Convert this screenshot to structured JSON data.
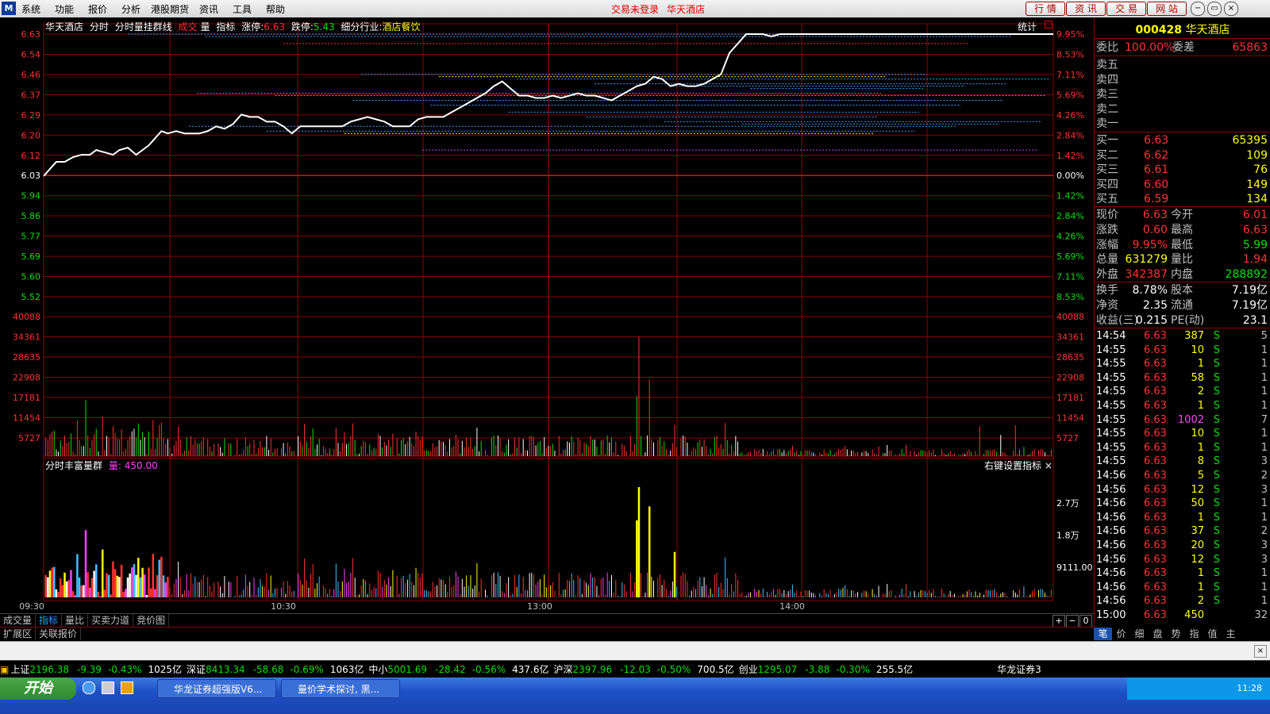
{
  "menubar": {
    "items": [
      "系统",
      "功能",
      "报价",
      "分析",
      "港股期货",
      "资讯",
      "工具",
      "帮助"
    ],
    "status_text": "交易未登录",
    "stock_title": "华天酒店",
    "right_buttons": [
      "行 情",
      "资 讯",
      "交 易",
      "网 站"
    ],
    "window_buttons": [
      "−",
      "▭",
      "×"
    ]
  },
  "chart_header": {
    "name": "华天酒店",
    "mode1": "分时",
    "mode2": "分时量挂群线",
    "vol_label1": "成交",
    "vol_label2": "量",
    "ind_label": "指标",
    "limit_up_label": "涨停:",
    "limit_up_value": "6.63",
    "limit_down_label": "跌停:",
    "limit_down_value": "5.43",
    "industry_label": "细分行业:",
    "industry_value": "酒店餐饮",
    "stat_label": "统计"
  },
  "sub_header": {
    "name": "分时丰富量群",
    "var_label": "量:",
    "var_value": "450.00",
    "right_text": "右键设置指标"
  },
  "chart_data": {
    "type": "line",
    "price_axis": {
      "left_ticks": [
        "6.63",
        "6.54",
        "6.46",
        "6.37",
        "6.29",
        "6.20",
        "6.12",
        "6.03",
        "5.94",
        "5.86",
        "5.77",
        "5.69",
        "5.60",
        "5.52"
      ],
      "right_ticks": [
        "9.95%",
        "8.53%",
        "7.11%",
        "5.69%",
        "4.26%",
        "2.84%",
        "1.42%",
        "0.00%",
        "1.42%",
        "2.84%",
        "4.26%",
        "5.69%",
        "7.11%",
        "8.53%"
      ],
      "ylim": [
        5.43,
        6.63
      ],
      "prev_close": 6.03
    },
    "volume_axis": {
      "ticks": [
        "40088",
        "34361",
        "28635",
        "22908",
        "17181",
        "11454",
        "5727"
      ],
      "ylim": [
        0,
        45815
      ]
    },
    "indicator_axis": {
      "ticks": [
        "2.7万",
        "1.8万",
        "9111.00"
      ],
      "ylim": [
        0,
        36000
      ]
    },
    "time_axis": {
      "labels": [
        "09:30",
        "10:30",
        "13:00",
        "14:00"
      ],
      "range_minutes": [
        0,
        240
      ]
    },
    "price_series": [
      [
        0,
        6.03
      ],
      [
        3,
        6.06
      ],
      [
        6,
        6.09
      ],
      [
        10,
        6.09
      ],
      [
        14,
        6.11
      ],
      [
        18,
        6.12
      ],
      [
        22,
        6.12
      ],
      [
        25,
        6.14
      ],
      [
        29,
        6.13
      ],
      [
        33,
        6.12
      ],
      [
        36,
        6.14
      ],
      [
        40,
        6.15
      ],
      [
        44,
        6.12
      ],
      [
        47,
        6.14
      ],
      [
        50,
        6.16
      ],
      [
        53,
        6.19
      ],
      [
        56,
        6.22
      ],
      [
        59,
        6.21
      ],
      [
        63,
        6.22
      ],
      [
        67,
        6.21
      ],
      [
        70,
        6.21
      ],
      [
        74,
        6.21
      ],
      [
        78,
        6.22
      ],
      [
        82,
        6.24
      ],
      [
        86,
        6.23
      ],
      [
        90,
        6.25
      ],
      [
        94,
        6.29
      ],
      [
        98,
        6.28
      ],
      [
        102,
        6.28
      ],
      [
        106,
        6.26
      ],
      [
        110,
        6.26
      ],
      [
        114,
        6.24
      ],
      [
        118,
        6.21
      ],
      [
        122,
        6.24
      ],
      [
        126,
        6.24
      ],
      [
        130,
        6.24
      ],
      [
        134,
        6.24
      ],
      [
        138,
        6.24
      ],
      [
        142,
        6.24
      ],
      [
        146,
        6.26
      ],
      [
        150,
        6.27
      ],
      [
        154,
        6.28
      ],
      [
        158,
        6.27
      ],
      [
        162,
        6.26
      ],
      [
        166,
        6.24
      ],
      [
        170,
        6.24
      ],
      [
        174,
        6.24
      ],
      [
        178,
        6.27
      ],
      [
        182,
        6.28
      ],
      [
        186,
        6.28
      ],
      [
        190,
        6.28
      ],
      [
        194,
        6.3
      ],
      [
        198,
        6.32
      ],
      [
        202,
        6.34
      ],
      [
        206,
        6.36
      ],
      [
        210,
        6.38
      ],
      [
        214,
        6.41
      ],
      [
        218,
        6.43
      ],
      [
        222,
        6.4
      ],
      [
        226,
        6.37
      ],
      [
        230,
        6.37
      ],
      [
        234,
        6.36
      ],
      [
        238,
        6.36
      ],
      [
        242,
        6.37
      ],
      [
        246,
        6.36
      ],
      [
        250,
        6.37
      ],
      [
        254,
        6.38
      ],
      [
        258,
        6.37
      ],
      [
        262,
        6.37
      ],
      [
        266,
        6.36
      ],
      [
        270,
        6.35
      ],
      [
        274,
        6.37
      ],
      [
        278,
        6.39
      ],
      [
        282,
        6.41
      ],
      [
        286,
        6.42
      ],
      [
        290,
        6.45
      ],
      [
        294,
        6.44
      ],
      [
        298,
        6.41
      ],
      [
        302,
        6.42
      ],
      [
        306,
        6.41
      ],
      [
        310,
        6.41
      ],
      [
        314,
        6.42
      ],
      [
        318,
        6.44
      ],
      [
        322,
        6.46
      ],
      [
        326,
        6.55
      ],
      [
        330,
        6.59
      ],
      [
        334,
        6.63
      ],
      [
        338,
        6.63
      ],
      [
        342,
        6.63
      ],
      [
        346,
        6.62
      ],
      [
        350,
        6.63
      ],
      [
        354,
        6.63
      ],
      [
        360,
        6.63
      ],
      [
        380,
        6.63
      ],
      [
        400,
        6.63
      ],
      [
        420,
        6.63
      ],
      [
        440,
        6.63
      ],
      [
        460,
        6.63
      ],
      [
        480,
        6.63
      ]
    ],
    "avg_series": [
      [
        0,
        6.03
      ],
      [
        20,
        6.08
      ],
      [
        40,
        6.1
      ],
      [
        60,
        6.14
      ],
      [
        80,
        6.17
      ],
      [
        100,
        6.2
      ],
      [
        120,
        6.22
      ],
      [
        140,
        6.23
      ],
      [
        160,
        6.24
      ],
      [
        180,
        6.26
      ],
      [
        200,
        6.27
      ],
      [
        220,
        6.3
      ],
      [
        240,
        6.31
      ],
      [
        260,
        6.33
      ],
      [
        280,
        6.35
      ],
      [
        300,
        6.37
      ],
      [
        320,
        6.39
      ],
      [
        340,
        6.44
      ],
      [
        360,
        6.47
      ],
      [
        400,
        6.5
      ],
      [
        440,
        6.52
      ],
      [
        480,
        6.53
      ]
    ],
    "volume_bars_note": "per-minute volume, red=up, green=down, white=flat",
    "volume_spike_values": [
      34361,
      22000,
      17181
    ],
    "indicator_spike_values": [
      36000,
      26000,
      22000,
      13000
    ]
  },
  "bottom_tabs": [
    "成交量",
    "指标",
    "量比",
    "买卖力道",
    "竞价图"
  ],
  "bottom_ctrl": [
    "+",
    "−",
    "0"
  ],
  "ext_tabs": [
    "扩展区",
    "关联报价"
  ],
  "quote": {
    "code": "000428",
    "name": "华天酒店",
    "wb_label": "委比",
    "wb_value": "100.00%",
    "wc_label": "委差",
    "wc_value": "65863",
    "sells": [
      {
        "label": "卖五",
        "price": "",
        "vol": ""
      },
      {
        "label": "卖四",
        "price": "",
        "vol": ""
      },
      {
        "label": "卖三",
        "price": "",
        "vol": ""
      },
      {
        "label": "卖二",
        "price": "",
        "vol": ""
      },
      {
        "label": "卖一",
        "price": "",
        "vol": ""
      }
    ],
    "buys": [
      {
        "label": "买一",
        "price": "6.63",
        "vol": "65395"
      },
      {
        "label": "买二",
        "price": "6.62",
        "vol": "109"
      },
      {
        "label": "买三",
        "price": "6.61",
        "vol": "76"
      },
      {
        "label": "买四",
        "price": "6.60",
        "vol": "149"
      },
      {
        "label": "买五",
        "price": "6.59",
        "vol": "134"
      }
    ],
    "stats": [
      {
        "l1": "现价",
        "v1": "6.63",
        "l2": "今开",
        "v2": "6.01"
      },
      {
        "l1": "涨跌",
        "v1": "0.60",
        "l2": "最高",
        "v2": "6.63"
      },
      {
        "l1": "涨幅",
        "v1": "9.95%",
        "l2": "最低",
        "v2": "5.99"
      },
      {
        "l1": "总量",
        "v1": "631279",
        "l2": "量比",
        "v2": "1.94"
      },
      {
        "l1": "外盘",
        "v1": "342387",
        "l2": "内盘",
        "v2": "288892"
      }
    ],
    "fund": [
      {
        "l1": "换手",
        "v1": "8.78%",
        "l2": "股本",
        "v2": "7.19亿"
      },
      {
        "l1": "净资",
        "v1": "2.35",
        "l2": "流通",
        "v2": "7.19亿"
      },
      {
        "l1": "收益(三)",
        "v1": "0.215",
        "l2": "PE(动)",
        "v2": "23.1"
      }
    ]
  },
  "ticks": [
    {
      "t": "14:54",
      "p": "6.63",
      "v": "387",
      "s": "S",
      "n": "5"
    },
    {
      "t": "14:55",
      "p": "6.63",
      "v": "10",
      "s": "S",
      "n": "1"
    },
    {
      "t": "14:55",
      "p": "6.63",
      "v": "1",
      "s": "S",
      "n": "1"
    },
    {
      "t": "14:55",
      "p": "6.63",
      "v": "58",
      "s": "S",
      "n": "1"
    },
    {
      "t": "14:55",
      "p": "6.63",
      "v": "2",
      "s": "S",
      "n": "1"
    },
    {
      "t": "14:55",
      "p": "6.63",
      "v": "1",
      "s": "S",
      "n": "1"
    },
    {
      "t": "14:55",
      "p": "6.63",
      "v": "1002",
      "s": "S",
      "n": "7"
    },
    {
      "t": "14:55",
      "p": "6.63",
      "v": "10",
      "s": "S",
      "n": "1"
    },
    {
      "t": "14:55",
      "p": "6.63",
      "v": "1",
      "s": "S",
      "n": "1"
    },
    {
      "t": "14:55",
      "p": "6.63",
      "v": "8",
      "s": "S",
      "n": "3"
    },
    {
      "t": "14:56",
      "p": "6.63",
      "v": "5",
      "s": "S",
      "n": "2"
    },
    {
      "t": "14:56",
      "p": "6.63",
      "v": "12",
      "s": "S",
      "n": "3"
    },
    {
      "t": "14:56",
      "p": "6.63",
      "v": "50",
      "s": "S",
      "n": "1"
    },
    {
      "t": "14:56",
      "p": "6.63",
      "v": "1",
      "s": "S",
      "n": "1"
    },
    {
      "t": "14:56",
      "p": "6.63",
      "v": "37",
      "s": "S",
      "n": "2"
    },
    {
      "t": "14:56",
      "p": "6.63",
      "v": "20",
      "s": "S",
      "n": "3"
    },
    {
      "t": "14:56",
      "p": "6.63",
      "v": "12",
      "s": "S",
      "n": "3"
    },
    {
      "t": "14:56",
      "p": "6.63",
      "v": "1",
      "s": "S",
      "n": "1"
    },
    {
      "t": "14:56",
      "p": "6.63",
      "v": "1",
      "s": "S",
      "n": "1"
    },
    {
      "t": "14:56",
      "p": "6.63",
      "v": "2",
      "s": "S",
      "n": "1"
    },
    {
      "t": "15:00",
      "p": "6.63",
      "v": "450",
      "s": "",
      "n": "32"
    }
  ],
  "rp_tabs": [
    "笔",
    "价",
    "细",
    "盘",
    "势",
    "指",
    "值",
    "主"
  ],
  "index_bar": [
    {
      "name": "上证",
      "val": "2196.38",
      "chg": "-9.39",
      "pct": "-0.43%",
      "amt": "1025亿"
    },
    {
      "name": "深证",
      "val": "8413.34",
      "chg": "-58.68",
      "pct": "-0.69%",
      "amt": "1063亿"
    },
    {
      "name": "中小",
      "val": "5001.69",
      "chg": "-28.42",
      "pct": "-0.56%",
      "amt": "437.6亿"
    },
    {
      "name": "沪深",
      "val": "2397.96",
      "chg": "-12.03",
      "pct": "-0.50%",
      "amt": "700.5亿"
    },
    {
      "name": "创业",
      "val": "1295.07",
      "chg": "-3.88",
      "pct": "-0.30%",
      "amt": "255.5亿"
    }
  ],
  "broker": "华龙证券3",
  "taskbar": {
    "start": "开始",
    "items": [
      "华龙证券超强版V6...",
      "量价学术探讨, 黑..."
    ],
    "clock": "11:28"
  },
  "colors": {
    "up": "#ff3232",
    "down": "#00e000",
    "grid": "#8b0000",
    "price": "#ffffff",
    "avg": "#ffff00",
    "accent": "#20a0ff"
  }
}
